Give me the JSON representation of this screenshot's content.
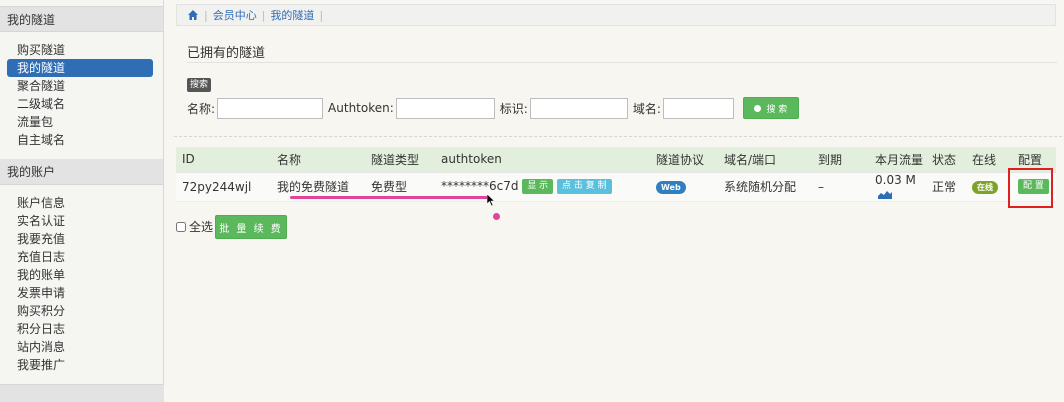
{
  "sidebar": {
    "sections": [
      {
        "header": "我的隧道",
        "items": [
          "购买隧道",
          "我的隧道",
          "聚合隧道",
          "二级域名",
          "流量包",
          "自主域名"
        ],
        "active_index": 1
      },
      {
        "header": "我的账户",
        "items": [
          "账户信息",
          "实名认证",
          "我要充值",
          "充值日志",
          "我的账单",
          "发票申请",
          "购买积分",
          "积分日志",
          "站内消息",
          "我要推广"
        ]
      }
    ]
  },
  "breadcrumb": {
    "items": [
      "会员中心",
      "我的隧道"
    ]
  },
  "page_title": "已拥有的隧道",
  "search": {
    "badge": "搜索",
    "name_label": "名称:",
    "authtoken_label": "Authtoken:",
    "id_label": "标识:",
    "domain_label": "域名:",
    "button_label": "搜 索"
  },
  "table": {
    "headers": [
      "ID",
      "名称",
      "隧道类型",
      "authtoken",
      "隧道协议",
      "域名/端口",
      "到期",
      "本月流量",
      "状态",
      "在线",
      "配置"
    ],
    "rows": [
      {
        "id": "72py244wjl",
        "name": "我的免费隧道",
        "type": "免费型",
        "authtoken": "********6c7d",
        "show_btn": "显 示",
        "copy_btn": "点 击 复 制",
        "protocol": "Web",
        "domain": "系统随机分配",
        "expire": "–",
        "traffic": "0.03 M",
        "status": "正常",
        "online": "在线",
        "config_btn": "配 置"
      }
    ]
  },
  "select_all_label": "全选",
  "batch_renew_label": "批 量 续 费",
  "colors": {
    "accent_blue": "#2f6db5",
    "green": "#5cb85c",
    "highlight_red": "#e02020",
    "annotation_pink": "#e0459a"
  }
}
